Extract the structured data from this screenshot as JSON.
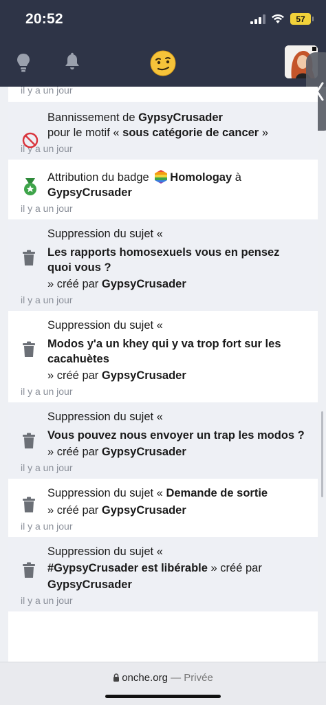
{
  "status_bar": {
    "time": "20:52",
    "battery": "57"
  },
  "log": {
    "first_timestamp": "il y a un jour",
    "entries": [
      {
        "icon": "ban-icon",
        "parts": [
          "Bannissement de ",
          "GypsyCrusader",
          " pour le motif « ",
          "sous catégorie de cancer",
          " »"
        ],
        "timestamp": "il y a un jour"
      },
      {
        "icon": "badge-medal-icon",
        "parts": [
          "Attribution du badge ",
          "Homologay",
          " à ",
          "GypsyCrusader"
        ],
        "timestamp": "il y a un jour"
      },
      {
        "icon": "trash-icon",
        "parts": [
          "Suppression du sujet « ",
          "Les rapports homosexuels vous en pensez quoi vous ?",
          " » créé par ",
          "GypsyCrusader"
        ],
        "timestamp": "il y a un jour"
      },
      {
        "icon": "trash-icon",
        "parts": [
          "Suppression du sujet « ",
          "Modos y'a un khey qui y va trop fort sur les cacahuètes",
          " » créé par ",
          "GypsyCrusader"
        ],
        "timestamp": "il y a un jour"
      },
      {
        "icon": "trash-icon",
        "parts": [
          "Suppression du sujet « ",
          "Vous pouvez nous envoyer un trap les modos ?",
          " » créé par ",
          "GypsyCrusader"
        ],
        "timestamp": "il y a un jour"
      },
      {
        "icon": "trash-icon",
        "parts": [
          "Suppression du sujet « ",
          "Demande de sortie",
          " » créé par ",
          "GypsyCrusader"
        ],
        "timestamp": "il y a un jour"
      },
      {
        "icon": "trash-icon",
        "parts": [
          "Suppression du sujet « ",
          "#GypsyCrusader est libérable",
          " » créé par ",
          "GypsyCrusader"
        ],
        "timestamp": "il y a un jour"
      }
    ]
  },
  "browser": {
    "domain": "onche.org",
    "separator": " — ",
    "privacy": "Privée"
  },
  "colors": {
    "header_bg": "#2e3447",
    "row_shade": "#eef0f5",
    "ban_red": "#d9363e",
    "badge_green": "#3ea44a",
    "trash_gray": "#6b6f76"
  }
}
